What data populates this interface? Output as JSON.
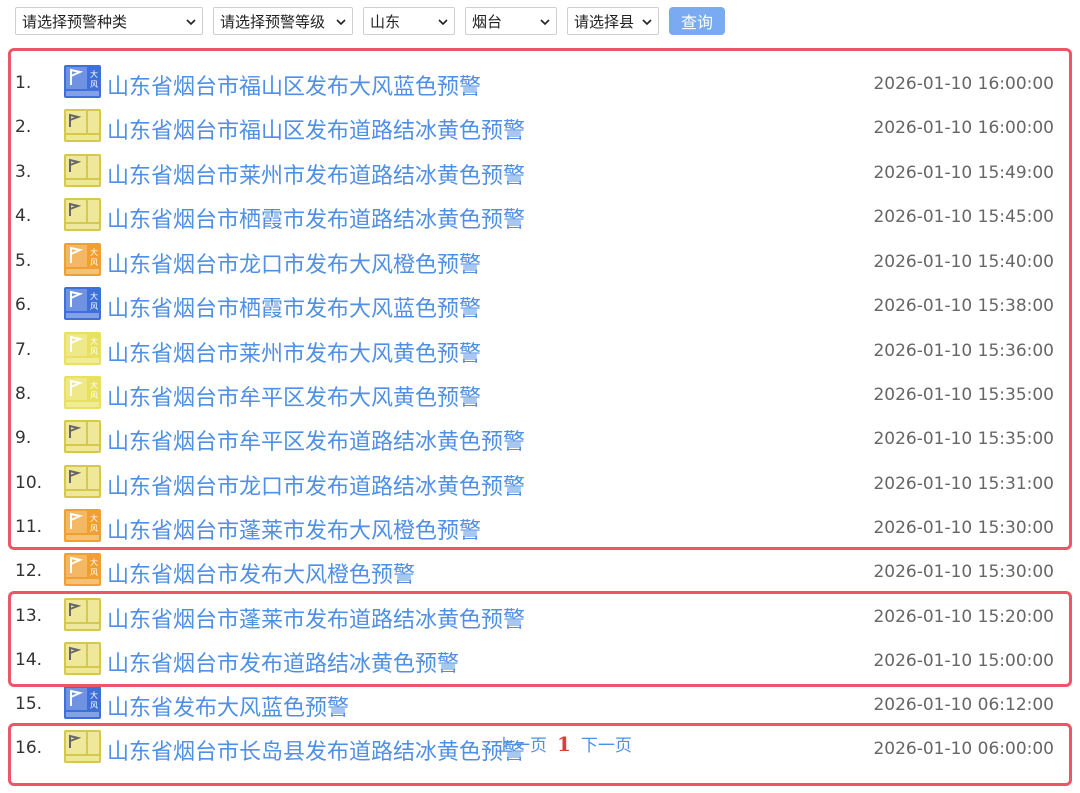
{
  "filters": {
    "type_select": "请选择预警种类",
    "level_select": "请选择预警等级",
    "province_select": "山东",
    "city_select": "烟台",
    "county_select": "请选择县",
    "query_button": "查询"
  },
  "icon_texts": {
    "wind_label": "大风",
    "road_label": "结冰"
  },
  "alerts": [
    {
      "num": "1.",
      "title": "山东省烟台市福山区发布大风蓝色预警",
      "time": "2026-01-10 16:00:00",
      "icon": "wind-blue-icon"
    },
    {
      "num": "2.",
      "title": "山东省烟台市福山区发布道路结冰黄色预警",
      "time": "2026-01-10 16:00:00",
      "icon": "road-icing-yellow-icon"
    },
    {
      "num": "3.",
      "title": "山东省烟台市莱州市发布道路结冰黄色预警",
      "time": "2026-01-10 15:49:00",
      "icon": "road-icing-yellow-icon"
    },
    {
      "num": "4.",
      "title": "山东省烟台市栖霞市发布道路结冰黄色预警",
      "time": "2026-01-10 15:45:00",
      "icon": "road-icing-yellow-icon"
    },
    {
      "num": "5.",
      "title": "山东省烟台市龙口市发布大风橙色预警",
      "time": "2026-01-10 15:40:00",
      "icon": "wind-orange-icon"
    },
    {
      "num": "6.",
      "title": "山东省烟台市栖霞市发布大风蓝色预警",
      "time": "2026-01-10 15:38:00",
      "icon": "wind-blue-icon"
    },
    {
      "num": "7.",
      "title": "山东省烟台市莱州市发布大风黄色预警",
      "time": "2026-01-10 15:36:00",
      "icon": "wind-yellow-icon"
    },
    {
      "num": "8.",
      "title": "山东省烟台市牟平区发布大风黄色预警",
      "time": "2026-01-10 15:35:00",
      "icon": "wind-yellow-icon"
    },
    {
      "num": "9.",
      "title": "山东省烟台市牟平区发布道路结冰黄色预警",
      "time": "2026-01-10 15:35:00",
      "icon": "road-icing-yellow-icon"
    },
    {
      "num": "10.",
      "title": "山东省烟台市龙口市发布道路结冰黄色预警",
      "time": "2026-01-10 15:31:00",
      "icon": "road-icing-yellow-icon"
    },
    {
      "num": "11.",
      "title": "山东省烟台市蓬莱市发布大风橙色预警",
      "time": "2026-01-10 15:30:00",
      "icon": "wind-orange-icon"
    },
    {
      "num": "12.",
      "title": "山东省烟台市发布大风橙色预警",
      "time": "2026-01-10 15:30:00",
      "icon": "wind-orange-icon"
    },
    {
      "num": "13.",
      "title": "山东省烟台市蓬莱市发布道路结冰黄色预警",
      "time": "2026-01-10 15:20:00",
      "icon": "road-icing-yellow-icon"
    },
    {
      "num": "14.",
      "title": "山东省烟台市发布道路结冰黄色预警",
      "time": "2026-01-10 15:00:00",
      "icon": "road-icing-yellow-icon"
    },
    {
      "num": "15.",
      "title": "山东省发布大风蓝色预警",
      "time": "2026-01-10 06:12:00",
      "icon": "wind-blue-icon"
    },
    {
      "num": "16.",
      "title": "山东省烟台市长岛县发布道路结冰黄色预警",
      "time": "2026-01-10 06:00:00",
      "icon": "road-icing-yellow-icon"
    }
  ],
  "pager": {
    "prev": "上一页",
    "current": "1",
    "next": "下一页"
  },
  "colors": {
    "link": "#4f8fe6",
    "highlight": "#ee5568",
    "button": "#7aaaf1",
    "blue": "#3f6fd9",
    "orange": "#f0a030",
    "yellow": "#e8e060"
  }
}
